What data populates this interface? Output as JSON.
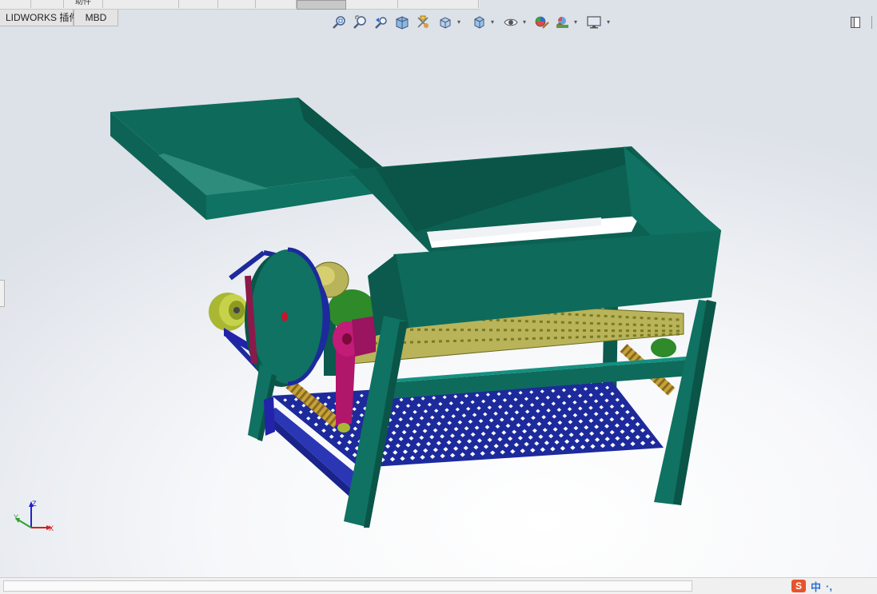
{
  "top_strip": {
    "segments": [
      "",
      "助件",
      "",
      "",
      "",
      "",
      "",
      "",
      ""
    ]
  },
  "command_tabs": [
    {
      "label": "LIDWORKS 插件"
    },
    {
      "label": "MBD"
    }
  ],
  "heads_up_toolbar": {
    "tools": [
      {
        "icon": "zoom-to-fit-icon"
      },
      {
        "icon": "zoom-to-area-icon"
      },
      {
        "icon": "previous-view-icon"
      },
      {
        "icon": "section-view-icon"
      },
      {
        "icon": "dynamic-annotation-views-icon"
      },
      {
        "icon": "view-orientation-icon"
      },
      {
        "icon": "display-style-icon"
      },
      {
        "icon": "hide-show-items-icon"
      },
      {
        "icon": "edit-appearance-icon"
      },
      {
        "icon": "apply-scene-icon"
      },
      {
        "icon": "view-settings-icon"
      }
    ]
  },
  "triad": {
    "x_label": "X",
    "y_label": "Y",
    "z_label": "Z"
  },
  "ime": {
    "logo": "S",
    "mode": "中",
    "punct": "·,"
  },
  "colors": {
    "frame": "#0e6b5c",
    "frame_dark": "#0a5548",
    "frame_top": "#107564",
    "screen": "#1d2a9c",
    "roller": "#b9b45a",
    "crank": "#b0176a",
    "pulley": "#b7c53a",
    "triad_x": "#d42020",
    "triad_y": "#2aa02a",
    "triad_z": "#2222cc"
  }
}
